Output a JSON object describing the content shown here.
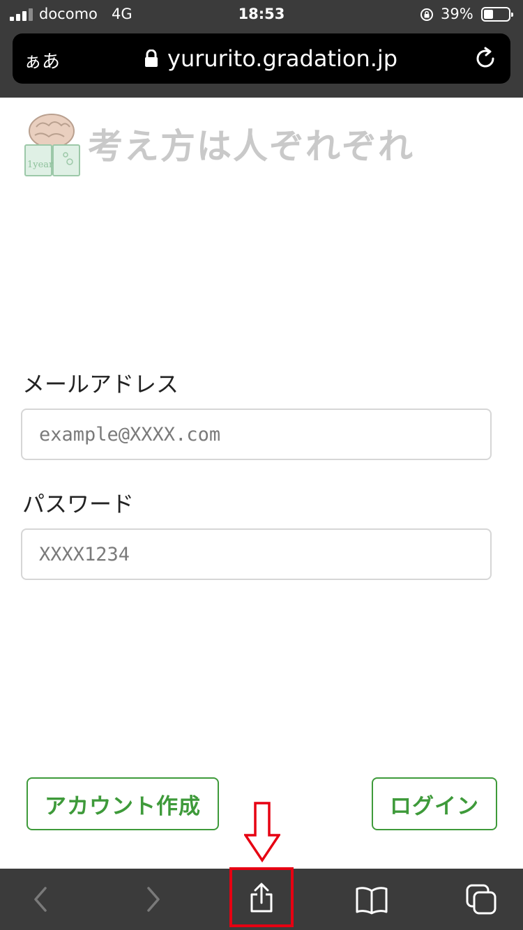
{
  "status_bar": {
    "carrier": "docomo",
    "network": "4G",
    "time": "18:53",
    "battery": "39%",
    "battery_level": 0.39
  },
  "browser": {
    "text_size_button": "ぁあ",
    "url": "yururito.gradation.jp",
    "toolbar_icons": [
      "back-icon",
      "forward-icon",
      "share-icon",
      "bookmarks-icon",
      "tabs-icon"
    ]
  },
  "site": {
    "title": "考え方は人ぞれぞれ",
    "logo_text": "1year",
    "title_color": "#c9c9c9"
  },
  "form": {
    "email_label": "メールアドレス",
    "email_placeholder": "example@XXXX.com",
    "password_label": "パスワード",
    "password_placeholder": "XXXX1234"
  },
  "buttons": {
    "create_account": "アカウント作成",
    "login": "ログイン",
    "accent_color": "#3e9a3a"
  },
  "annotation": {
    "highlight_color": "#e60012",
    "target": "share-icon"
  }
}
